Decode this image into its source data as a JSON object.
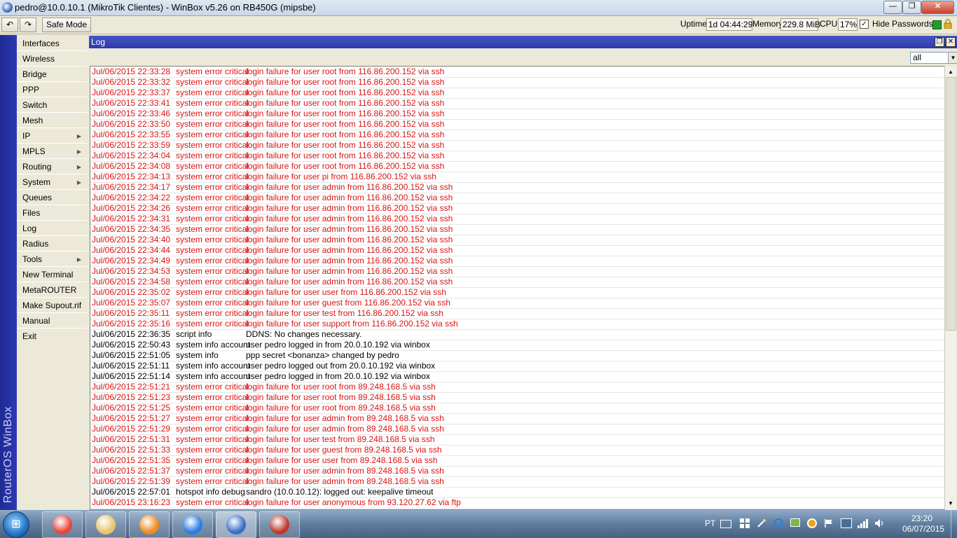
{
  "window": {
    "title": "pedro@10.0.10.1 (MikroTik Clientes) - WinBox v5.26 on RB450G (mipsbe)",
    "minimize": "—",
    "maximize": "❐",
    "close": "✕"
  },
  "toolbar": {
    "undo": "↶",
    "redo": "↷",
    "safe_mode": "Safe Mode",
    "uptime_label": "Uptime:",
    "uptime_value": "1d 04:44:29",
    "memory_label": "Memory:",
    "memory_value": "229.8 MiB",
    "cpu_label": "CPU:",
    "cpu_value": "17%",
    "hide_passwords_label": "Hide Passwords",
    "hide_passwords_checked": "✓"
  },
  "sidebar": {
    "brand": "RouterOS WinBox",
    "items": [
      {
        "label": "Interfaces",
        "arrow": ""
      },
      {
        "label": "Wireless",
        "arrow": ""
      },
      {
        "label": "Bridge",
        "arrow": ""
      },
      {
        "label": "PPP",
        "arrow": ""
      },
      {
        "label": "Switch",
        "arrow": ""
      },
      {
        "label": "Mesh",
        "arrow": ""
      },
      {
        "label": "IP",
        "arrow": "▶"
      },
      {
        "label": "MPLS",
        "arrow": "▶"
      },
      {
        "label": "Routing",
        "arrow": "▶"
      },
      {
        "label": "System",
        "arrow": "▶"
      },
      {
        "label": "Queues",
        "arrow": ""
      },
      {
        "label": "Files",
        "arrow": ""
      },
      {
        "label": "Log",
        "arrow": ""
      },
      {
        "label": "Radius",
        "arrow": ""
      },
      {
        "label": "Tools",
        "arrow": "▶"
      },
      {
        "label": "New Terminal",
        "arrow": ""
      },
      {
        "label": "MetaROUTER",
        "arrow": ""
      },
      {
        "label": "Make Supout.rif",
        "arrow": ""
      },
      {
        "label": "Manual",
        "arrow": ""
      },
      {
        "label": "Exit",
        "arrow": ""
      }
    ]
  },
  "log": {
    "title": "Log",
    "restore_btn": "❐",
    "close_btn": "✕",
    "filter_value": "all",
    "filter_arrow": "▼",
    "scroll_up": "▲",
    "scroll_down": "▼",
    "rows": [
      {
        "time": "Jul/06/2015 22:33:28",
        "topics": "system error critical",
        "message": "login failure for user root from 116.86.200.152 via ssh",
        "level": "err"
      },
      {
        "time": "Jul/06/2015 22:33:32",
        "topics": "system error critical",
        "message": "login failure for user root from 116.86.200.152 via ssh",
        "level": "err"
      },
      {
        "time": "Jul/06/2015 22:33:37",
        "topics": "system error critical",
        "message": "login failure for user root from 116.86.200.152 via ssh",
        "level": "err"
      },
      {
        "time": "Jul/06/2015 22:33:41",
        "topics": "system error critical",
        "message": "login failure for user root from 116.86.200.152 via ssh",
        "level": "err"
      },
      {
        "time": "Jul/06/2015 22:33:46",
        "topics": "system error critical",
        "message": "login failure for user root from 116.86.200.152 via ssh",
        "level": "err"
      },
      {
        "time": "Jul/06/2015 22:33:50",
        "topics": "system error critical",
        "message": "login failure for user root from 116.86.200.152 via ssh",
        "level": "err"
      },
      {
        "time": "Jul/06/2015 22:33:55",
        "topics": "system error critical",
        "message": "login failure for user root from 116.86.200.152 via ssh",
        "level": "err"
      },
      {
        "time": "Jul/06/2015 22:33:59",
        "topics": "system error critical",
        "message": "login failure for user root from 116.86.200.152 via ssh",
        "level": "err"
      },
      {
        "time": "Jul/06/2015 22:34:04",
        "topics": "system error critical",
        "message": "login failure for user root from 116.86.200.152 via ssh",
        "level": "err"
      },
      {
        "time": "Jul/06/2015 22:34:08",
        "topics": "system error critical",
        "message": "login failure for user root from 116.86.200.152 via ssh",
        "level": "err"
      },
      {
        "time": "Jul/06/2015 22:34:13",
        "topics": "system error critical",
        "message": "login failure for user pi from 116.86.200.152 via ssh",
        "level": "err"
      },
      {
        "time": "Jul/06/2015 22:34:17",
        "topics": "system error critical",
        "message": "login failure for user admin from 116.86.200.152 via ssh",
        "level": "err"
      },
      {
        "time": "Jul/06/2015 22:34:22",
        "topics": "system error critical",
        "message": "login failure for user admin from 116.86.200.152 via ssh",
        "level": "err"
      },
      {
        "time": "Jul/06/2015 22:34:26",
        "topics": "system error critical",
        "message": "login failure for user admin from 116.86.200.152 via ssh",
        "level": "err"
      },
      {
        "time": "Jul/06/2015 22:34:31",
        "topics": "system error critical",
        "message": "login failure for user admin from 116.86.200.152 via ssh",
        "level": "err"
      },
      {
        "time": "Jul/06/2015 22:34:35",
        "topics": "system error critical",
        "message": "login failure for user admin from 116.86.200.152 via ssh",
        "level": "err"
      },
      {
        "time": "Jul/06/2015 22:34:40",
        "topics": "system error critical",
        "message": "login failure for user admin from 116.86.200.152 via ssh",
        "level": "err"
      },
      {
        "time": "Jul/06/2015 22:34:44",
        "topics": "system error critical",
        "message": "login failure for user admin from 116.86.200.152 via ssh",
        "level": "err"
      },
      {
        "time": "Jul/06/2015 22:34:49",
        "topics": "system error critical",
        "message": "login failure for user admin from 116.86.200.152 via ssh",
        "level": "err"
      },
      {
        "time": "Jul/06/2015 22:34:53",
        "topics": "system error critical",
        "message": "login failure for user admin from 116.86.200.152 via ssh",
        "level": "err"
      },
      {
        "time": "Jul/06/2015 22:34:58",
        "topics": "system error critical",
        "message": "login failure for user admin from 116.86.200.152 via ssh",
        "level": "err"
      },
      {
        "time": "Jul/06/2015 22:35:02",
        "topics": "system error critical",
        "message": "login failure for user user from 116.86.200.152 via ssh",
        "level": "err"
      },
      {
        "time": "Jul/06/2015 22:35:07",
        "topics": "system error critical",
        "message": "login failure for user guest from 116.86.200.152 via ssh",
        "level": "err"
      },
      {
        "time": "Jul/06/2015 22:35:11",
        "topics": "system error critical",
        "message": "login failure for user test from 116.86.200.152 via ssh",
        "level": "err"
      },
      {
        "time": "Jul/06/2015 22:35:16",
        "topics": "system error critical",
        "message": "login failure for user support from 116.86.200.152 via ssh",
        "level": "err"
      },
      {
        "time": "Jul/06/2015 22:36:35",
        "topics": "script info",
        "message": "DDNS: No changes necessary.",
        "level": "info"
      },
      {
        "time": "Jul/06/2015 22:50:43",
        "topics": "system info account",
        "message": "user pedro logged in from 20.0.10.192 via winbox",
        "level": "info"
      },
      {
        "time": "Jul/06/2015 22:51:05",
        "topics": "system info",
        "message": "ppp secret <bonanza> changed by pedro",
        "level": "info"
      },
      {
        "time": "Jul/06/2015 22:51:11",
        "topics": "system info account",
        "message": "user pedro logged out from 20.0.10.192 via winbox",
        "level": "info"
      },
      {
        "time": "Jul/06/2015 22:51:14",
        "topics": "system info account",
        "message": "user pedro logged in from 20.0.10.192 via winbox",
        "level": "info"
      },
      {
        "time": "Jul/06/2015 22:51:21",
        "topics": "system error critical",
        "message": "login failure for user root from 89.248.168.5 via ssh",
        "level": "err"
      },
      {
        "time": "Jul/06/2015 22:51:23",
        "topics": "system error critical",
        "message": "login failure for user root from 89.248.168.5 via ssh",
        "level": "err"
      },
      {
        "time": "Jul/06/2015 22:51:25",
        "topics": "system error critical",
        "message": "login failure for user root from 89.248.168.5 via ssh",
        "level": "err"
      },
      {
        "time": "Jul/06/2015 22:51:27",
        "topics": "system error critical",
        "message": "login failure for user admin from 89.248.168.5 via ssh",
        "level": "err"
      },
      {
        "time": "Jul/06/2015 22:51:29",
        "topics": "system error critical",
        "message": "login failure for user admin from 89.248.168.5 via ssh",
        "level": "err"
      },
      {
        "time": "Jul/06/2015 22:51:31",
        "topics": "system error critical",
        "message": "login failure for user test from 89.248.168.5 via ssh",
        "level": "err"
      },
      {
        "time": "Jul/06/2015 22:51:33",
        "topics": "system error critical",
        "message": "login failure for user guest from 89.248.168.5 via ssh",
        "level": "err"
      },
      {
        "time": "Jul/06/2015 22:51:35",
        "topics": "system error critical",
        "message": "login failure for user user from 89.248.168.5 via ssh",
        "level": "err"
      },
      {
        "time": "Jul/06/2015 22:51:37",
        "topics": "system error critical",
        "message": "login failure for user admin from 89.248.168.5 via ssh",
        "level": "err"
      },
      {
        "time": "Jul/06/2015 22:51:39",
        "topics": "system error critical",
        "message": "login failure for user admin from 89.248.168.5 via ssh",
        "level": "err"
      },
      {
        "time": "Jul/06/2015 22:57:01",
        "topics": "hotspot info debug",
        "message": "sandro (10.0.10.12): logged out: keepalive timeout",
        "level": "info"
      },
      {
        "time": "Jul/06/2015 23:16:23",
        "topics": "system error critical",
        "message": "login failure for user anonymous from 93.120.27.62 via ftp",
        "level": "err"
      }
    ]
  },
  "taskbar": {
    "start_glyph": "⊞",
    "language": "PT",
    "clock_time": "23:20",
    "clock_date": "06/07/2015",
    "apps": [
      {
        "name": "chrome-icon",
        "color": "#e8453c",
        "active": false
      },
      {
        "name": "file-explorer-icon",
        "color": "#e9c46a",
        "active": false
      },
      {
        "name": "media-player-icon",
        "color": "#f08a24",
        "active": false
      },
      {
        "name": "messenger-icon",
        "color": "#2a7de1",
        "active": false
      },
      {
        "name": "winbox-icon",
        "color": "#3b6fc6",
        "active": true
      },
      {
        "name": "app-icon",
        "color": "#c0392b",
        "active": false
      }
    ]
  }
}
